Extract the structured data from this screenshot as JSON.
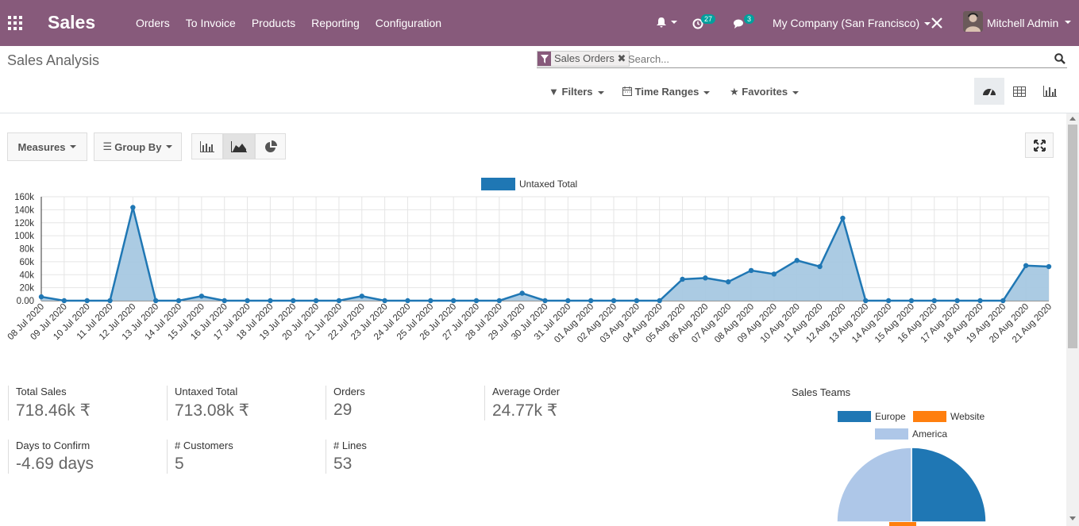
{
  "navbar": {
    "brand": "Sales",
    "menu": [
      "Orders",
      "To Invoice",
      "Products",
      "Reporting",
      "Configuration"
    ],
    "activity_count": "27",
    "message_count": "3",
    "company": "My Company (San Francisco)",
    "user": "Mitchell Admin"
  },
  "page": {
    "title": "Sales Analysis"
  },
  "search": {
    "facet": "Sales Orders",
    "placeholder": "Search..."
  },
  "options": {
    "filters": "Filters",
    "time_ranges": "Time Ranges",
    "favorites": "Favorites"
  },
  "toolbar": {
    "measures": "Measures",
    "group_by": "Group By"
  },
  "colors": {
    "brand": "#875a7b",
    "series": "#1f77b4",
    "fill": "#a6c8e2",
    "badge": "#00a09d",
    "orange": "#ff7f0e",
    "light": "#aec7e8"
  },
  "chart_data": [
    {
      "type": "area",
      "legend": [
        "Untaxed Total"
      ],
      "ylim": [
        0,
        160000
      ],
      "yticks": [
        "0.00",
        "20k",
        "40k",
        "60k",
        "80k",
        "100k",
        "120k",
        "140k",
        "160k"
      ],
      "x": [
        "08 Jul 2020",
        "09 Jul 2020",
        "10 Jul 2020",
        "11 Jul 2020",
        "12 Jul 2020",
        "13 Jul 2020",
        "14 Jul 2020",
        "15 Jul 2020",
        "16 Jul 2020",
        "17 Jul 2020",
        "18 Jul 2020",
        "19 Jul 2020",
        "20 Jul 2020",
        "21 Jul 2020",
        "22 Jul 2020",
        "23 Jul 2020",
        "24 Jul 2020",
        "25 Jul 2020",
        "26 Jul 2020",
        "27 Jul 2020",
        "28 Jul 2020",
        "29 Jul 2020",
        "30 Jul 2020",
        "31 Jul 2020",
        "01 Aug 2020",
        "02 Aug 2020",
        "03 Aug 2020",
        "04 Aug 2020",
        "05 Aug 2020",
        "06 Aug 2020",
        "07 Aug 2020",
        "08 Aug 2020",
        "09 Aug 2020",
        "10 Aug 2020",
        "11 Aug 2020",
        "12 Aug 2020",
        "13 Aug 2020",
        "14 Aug 2020",
        "15 Aug 2020",
        "16 Aug 2020",
        "17 Aug 2020",
        "18 Aug 2020",
        "19 Aug 2020",
        "20 Aug 2020",
        "21 Aug 2020"
      ],
      "series": [
        {
          "name": "Untaxed Total",
          "values": [
            6000,
            0,
            0,
            0,
            143500,
            0,
            0,
            7000,
            0,
            0,
            0,
            0,
            0,
            0,
            7000,
            0,
            0,
            0,
            0,
            0,
            0,
            11500,
            0,
            0,
            0,
            0,
            0,
            0,
            33000,
            35000,
            29000,
            46500,
            41000,
            62000,
            52500,
            127000,
            0,
            0,
            0,
            0,
            0,
            0,
            0,
            54000,
            52500
          ]
        }
      ],
      "grid": true
    },
    {
      "type": "pie",
      "title": "Sales Teams",
      "legend": [
        "Europe",
        "Website",
        "America"
      ]
    }
  ],
  "kpis": [
    {
      "label": "Total Sales",
      "value": "718.46k ₹"
    },
    {
      "label": "Untaxed Total",
      "value": "713.08k ₹"
    },
    {
      "label": "Orders",
      "value": "29"
    },
    {
      "label": "Average Order",
      "value": "24.77k ₹"
    },
    {
      "label": "Days to Confirm",
      "value": "-4.69 days"
    },
    {
      "label": "# Customers",
      "value": "5"
    },
    {
      "label": "# Lines",
      "value": "53"
    }
  ]
}
